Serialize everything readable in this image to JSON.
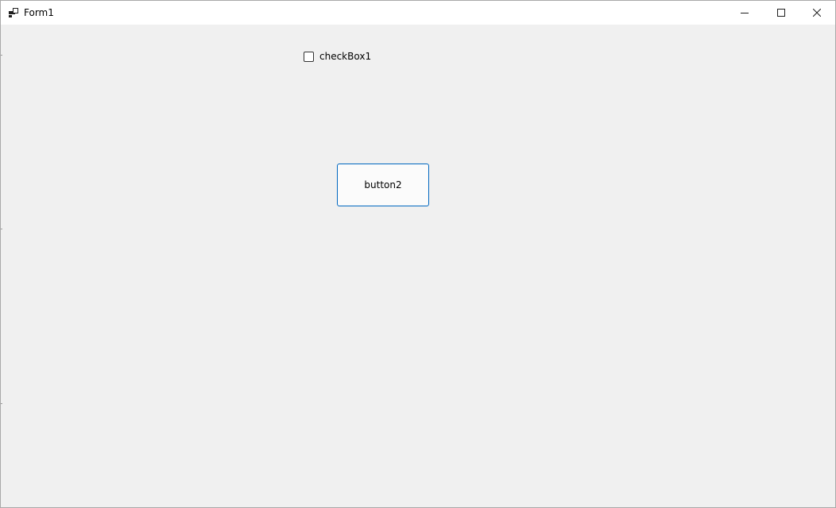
{
  "window": {
    "title": "Form1",
    "icon": "form-icon",
    "controls": {
      "minimize_icon": "minimize-icon",
      "maximize_icon": "maximize-icon",
      "close_icon": "close-icon"
    }
  },
  "form": {
    "checkbox": {
      "label": "checkBox1",
      "checked": false
    },
    "button": {
      "label": "button2"
    }
  },
  "colors": {
    "form_background": "#f0f0f0",
    "titlebar_background": "#ffffff",
    "button_border_accent": "#0067c0",
    "button_background": "#fbfbfb"
  }
}
